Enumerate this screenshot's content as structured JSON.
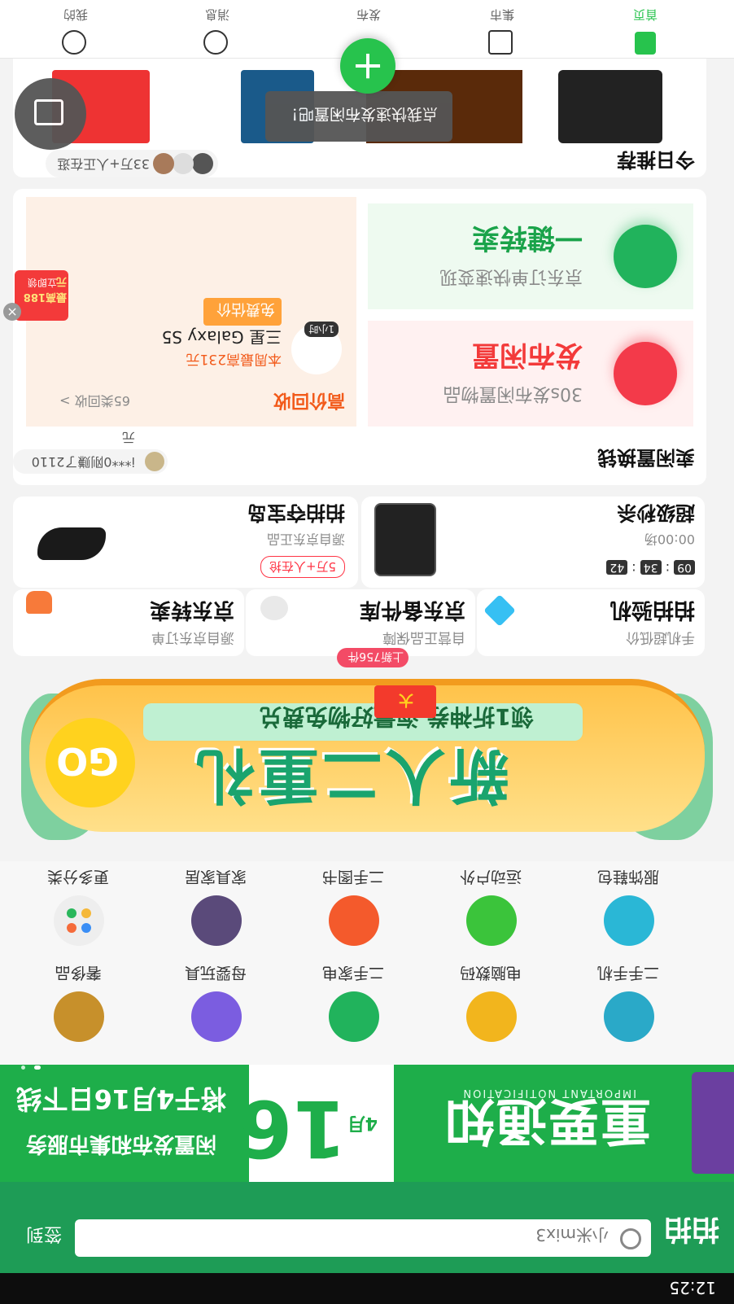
{
  "status_bar": {
    "time": "12:25"
  },
  "search": {
    "logo": "拍拍",
    "placeholder": "小米mix3",
    "sign_in": "签到"
  },
  "notice_banner": {
    "title": "重要通知",
    "subtitle": "IMPORTANT NOTIFICATION",
    "date_month": "4月",
    "date_day": "16",
    "line1": "闲置发布和集市服务",
    "line2": "将于4月16日下线"
  },
  "categories": [
    {
      "label": "二手手机",
      "icon": "phone-category-icon",
      "color": "#2aa9c8"
    },
    {
      "label": "电脑数码",
      "icon": "computer-category-icon",
      "color": "#f2b51d"
    },
    {
      "label": "二手家电",
      "icon": "appliance-category-icon",
      "color": "#21b35c"
    },
    {
      "label": "母婴玩具",
      "icon": "baby-toys-category-icon",
      "color": "#7b5de0"
    },
    {
      "label": "奢侈品",
      "icon": "luxury-category-icon",
      "color": "#c7902b"
    },
    {
      "label": "服饰鞋包",
      "icon": "apparel-category-icon",
      "color": "#2ab7d6"
    },
    {
      "label": "运动户外",
      "icon": "outdoor-category-icon",
      "color": "#3bc43b"
    },
    {
      "label": "二手图书",
      "icon": "books-category-icon",
      "color": "#f45a2c"
    },
    {
      "label": "家具家居",
      "icon": "furniture-category-icon",
      "color": "#5a4a7a"
    },
    {
      "label": "更多分类",
      "icon": "more-category-icon",
      "color": "#eeeeee"
    }
  ],
  "promo_banner": {
    "title": "新人二重礼",
    "subtitle": "领1折神券 海量好物免费兑",
    "go": "GO",
    "badge": "大"
  },
  "quick_tiles": [
    {
      "title": "拍拍验机",
      "sub": "手机超低价"
    },
    {
      "title": "京东备件库",
      "sub": "自营正品保障",
      "badge": "上新756件"
    },
    {
      "title": "京东转卖",
      "sub": "源自京东订单"
    }
  ],
  "flash_sale": {
    "title": "超级秒杀",
    "time_label": "00:00场",
    "h": "09",
    "m": "34",
    "s": "42"
  },
  "treasure": {
    "title": "拍拍夺宝岛",
    "sub": "源自京东正品",
    "tag": "5万+人在抢"
  },
  "swap_section": {
    "title": "卖闲置换钱",
    "ticker": "i***0刚赚了2110元",
    "publish_title": "发布闲置",
    "publish_sub": "30s发布闲置物品",
    "oneclick_title": "一键转卖",
    "oneclick_sub": "京东订单快速变现",
    "recycle_title": "高价回收",
    "recycle_link": "65类回收 >",
    "product_name": "三星 Galaxy S5",
    "product_price": "本周最高231元",
    "product_badge": "1小时",
    "estimate_button": "免费估价",
    "red_envelope": "最高188元",
    "red_envelope_sub": "立即领"
  },
  "today_section": {
    "title": "今日推荐",
    "watchers": "33万+人正在逛"
  },
  "tooltip": {
    "text": "点我快速发布闲置吧！"
  },
  "bottom_nav": [
    {
      "label": "首页"
    },
    {
      "label": "集市"
    },
    {
      "label": "发布"
    },
    {
      "label": "消息"
    },
    {
      "label": "我的"
    }
  ],
  "colors": {
    "brand_green": "#1aa34a",
    "nav_green": "#27c34d",
    "publish_red": "#f33a4a"
  }
}
